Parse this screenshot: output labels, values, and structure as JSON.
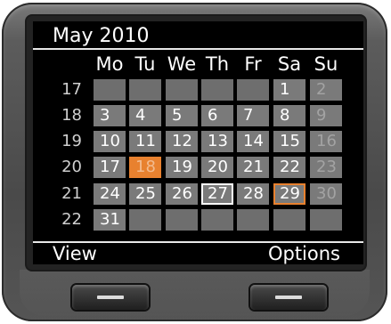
{
  "calendar": {
    "month_title": "May 2010",
    "weekdays": [
      "Mo",
      "Tu",
      "We",
      "Th",
      "Fr",
      "Sa",
      "Su"
    ],
    "weeks": [
      {
        "number": "17",
        "days": [
          "",
          "",
          "",
          "",
          "",
          "1",
          "2"
        ]
      },
      {
        "number": "18",
        "days": [
          "3",
          "4",
          "5",
          "6",
          "7",
          "8",
          "9"
        ]
      },
      {
        "number": "19",
        "days": [
          "10",
          "11",
          "12",
          "13",
          "14",
          "15",
          "16"
        ]
      },
      {
        "number": "20",
        "days": [
          "17",
          "18",
          "19",
          "20",
          "21",
          "22",
          "23"
        ]
      },
      {
        "number": "21",
        "days": [
          "24",
          "25",
          "26",
          "27",
          "28",
          "29",
          "30"
        ]
      },
      {
        "number": "22",
        "days": [
          "31",
          "",
          "",
          "",
          "",
          "",
          ""
        ]
      }
    ],
    "selected_day": "18",
    "today_day": "27",
    "marked_day": "29",
    "colors": {
      "selected": "#e8812f",
      "cell": "#7a7a7a",
      "screen": "#000000"
    }
  },
  "softkeys": {
    "left_label": "View",
    "right_label": "Options"
  },
  "hardware": {
    "left_key_icon": "minus-bar-icon",
    "right_key_icon": "minus-bar-icon"
  }
}
